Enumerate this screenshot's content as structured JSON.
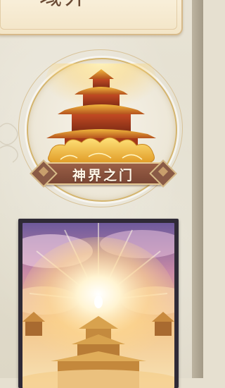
{
  "title_card": {
    "title": "域外"
  },
  "portal": {
    "label": "神界之门",
    "icon": "celestial-temple-icon"
  },
  "preview_card": {
    "image": "heavenly-light-temple-art"
  },
  "colors": {
    "banner": "#8a5040",
    "gold": "#e6b23a",
    "parchment": "#f7eedb"
  }
}
